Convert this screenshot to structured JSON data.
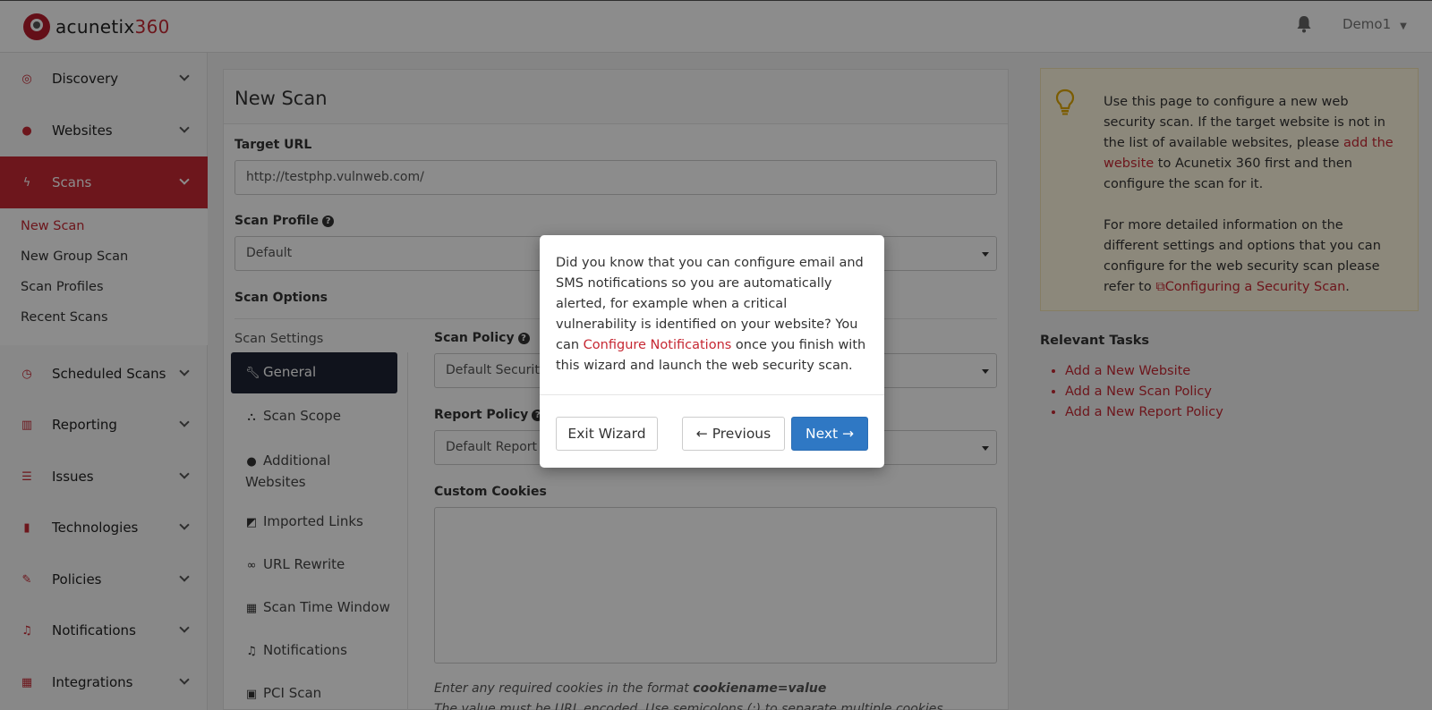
{
  "header": {
    "logo_text": "acunetix",
    "logo_num": "360",
    "user": "Demo1"
  },
  "sidebar": {
    "items": [
      {
        "label": "Discovery",
        "icon": "target-icon"
      },
      {
        "label": "Websites",
        "icon": "globe-icon"
      },
      {
        "label": "Scans",
        "icon": "bolt-icon"
      },
      {
        "label": "Scheduled Scans",
        "icon": "clock-icon"
      },
      {
        "label": "Reporting",
        "icon": "bar-chart-icon"
      },
      {
        "label": "Issues",
        "icon": "list-icon"
      },
      {
        "label": "Technologies",
        "icon": "server-icon"
      },
      {
        "label": "Policies",
        "icon": "edit-icon"
      },
      {
        "label": "Notifications",
        "icon": "bell-icon"
      },
      {
        "label": "Integrations",
        "icon": "puzzle-icon"
      }
    ],
    "scans_sub": [
      "New Scan",
      "New Group Scan",
      "Scan Profiles",
      "Recent Scans"
    ]
  },
  "main": {
    "title": "New Scan",
    "target_url_label": "Target URL",
    "target_url_value": "http://testphp.vulnweb.com/",
    "scan_profile_label": "Scan Profile",
    "scan_profile_value": "Default",
    "scan_options_label": "Scan Options",
    "scan_settings_label": "Scan Settings",
    "settings_nav": [
      {
        "label": "General",
        "icon": "wrench-icon"
      },
      {
        "label": "Scan Scope",
        "icon": "sitemap-icon"
      },
      {
        "label": "Additional",
        "label2": "Websites",
        "icon": "globe-icon"
      },
      {
        "label": "Imported Links",
        "icon": "external-link-icon"
      },
      {
        "label": "URL Rewrite",
        "icon": "link-icon"
      },
      {
        "label": "Scan Time Window",
        "icon": "calendar-icon"
      },
      {
        "label": "Notifications",
        "icon": "bell-icon"
      },
      {
        "label": "PCI Scan",
        "icon": "pci-icon"
      }
    ],
    "scan_policy_label": "Scan Policy",
    "scan_policy_value": "Default Security",
    "report_policy_label": "Report Policy",
    "report_policy_value": "Default Report P",
    "custom_cookies_label": "Custom Cookies",
    "cookies_hint_prefix": "Enter any required cookies in the format ",
    "cookies_hint_bold": "cookiename=value",
    "cookies_hint_2": "The value must be URL encoded. Use semicolons (;) to separate multiple cookies."
  },
  "info": {
    "p1_a": "Use this page to configure a new web security scan. If the target website is not in the list of available websites, please ",
    "p1_link": "add the website",
    "p1_b": " to Acunetix 360 first and then configure the scan for it.",
    "p2_a": "For more detailed information on the different settings and options that you can configure for the web security scan please refer to ",
    "p2_link": "Configuring a Security Scan",
    "p2_b": "."
  },
  "tasks": {
    "title": "Relevant Tasks",
    "items": [
      "Add a New Website",
      "Add a New Scan Policy",
      "Add a New Report Policy"
    ]
  },
  "modal": {
    "text_a": "Did you know that you can configure email and SMS notifications so you are automatically alerted, for example when a critical vulnerability is identified on your website? You can ",
    "link": "Configure Notifications",
    "text_b": " once you finish with this wizard and launch the web security scan.",
    "exit": "Exit Wizard",
    "previous": "← Previous",
    "next": "Next →"
  },
  "colors": {
    "accent": "#c62833",
    "primary": "#2f78c4",
    "dark": "#1e2433"
  }
}
